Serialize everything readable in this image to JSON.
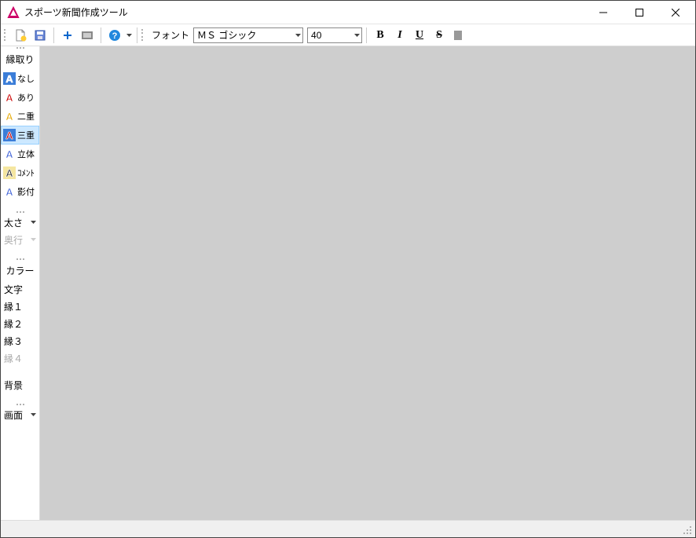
{
  "window": {
    "title": "スポーツ新聞作成ツール"
  },
  "toolbar": {
    "font_label": "フォント",
    "font_value": "ＭＳ ゴシック",
    "size_value": "40",
    "bold": "B",
    "italic": "I",
    "underline": "U",
    "strike": "S"
  },
  "sidebar": {
    "outline_header": "縁取り",
    "styles": [
      {
        "label": "なし",
        "selected": false,
        "iconBg": "#3b7dd8",
        "iconFg": "#ffffff"
      },
      {
        "label": "あり",
        "selected": false,
        "iconBg": "#ffffff",
        "iconFg": "#cc0000"
      },
      {
        "label": "二重",
        "selected": false,
        "iconBg": "#ffffff",
        "iconFg": "#e6a800"
      },
      {
        "label": "三重",
        "selected": true,
        "iconBg": "#3b7dd8",
        "iconFg": "#cc0000"
      },
      {
        "label": "立体",
        "selected": false,
        "iconBg": "#ffffff",
        "iconFg": "#3b5fd8"
      },
      {
        "label": "ｺﾒﾝﾄ",
        "selected": false,
        "iconBg": "#f5e6a0",
        "iconFg": "#333333"
      },
      {
        "label": "影付",
        "selected": false,
        "iconBg": "#ffffff",
        "iconFg": "#3b5fd8"
      }
    ],
    "thickness": "太さ",
    "depth": "奥行",
    "color": "カラー",
    "text": "文字",
    "edges": [
      {
        "label": "縁１",
        "enabled": true
      },
      {
        "label": "縁２",
        "enabled": true
      },
      {
        "label": "縁３",
        "enabled": true
      },
      {
        "label": "縁４",
        "enabled": false
      }
    ],
    "background": "背景",
    "screen": "画面"
  }
}
